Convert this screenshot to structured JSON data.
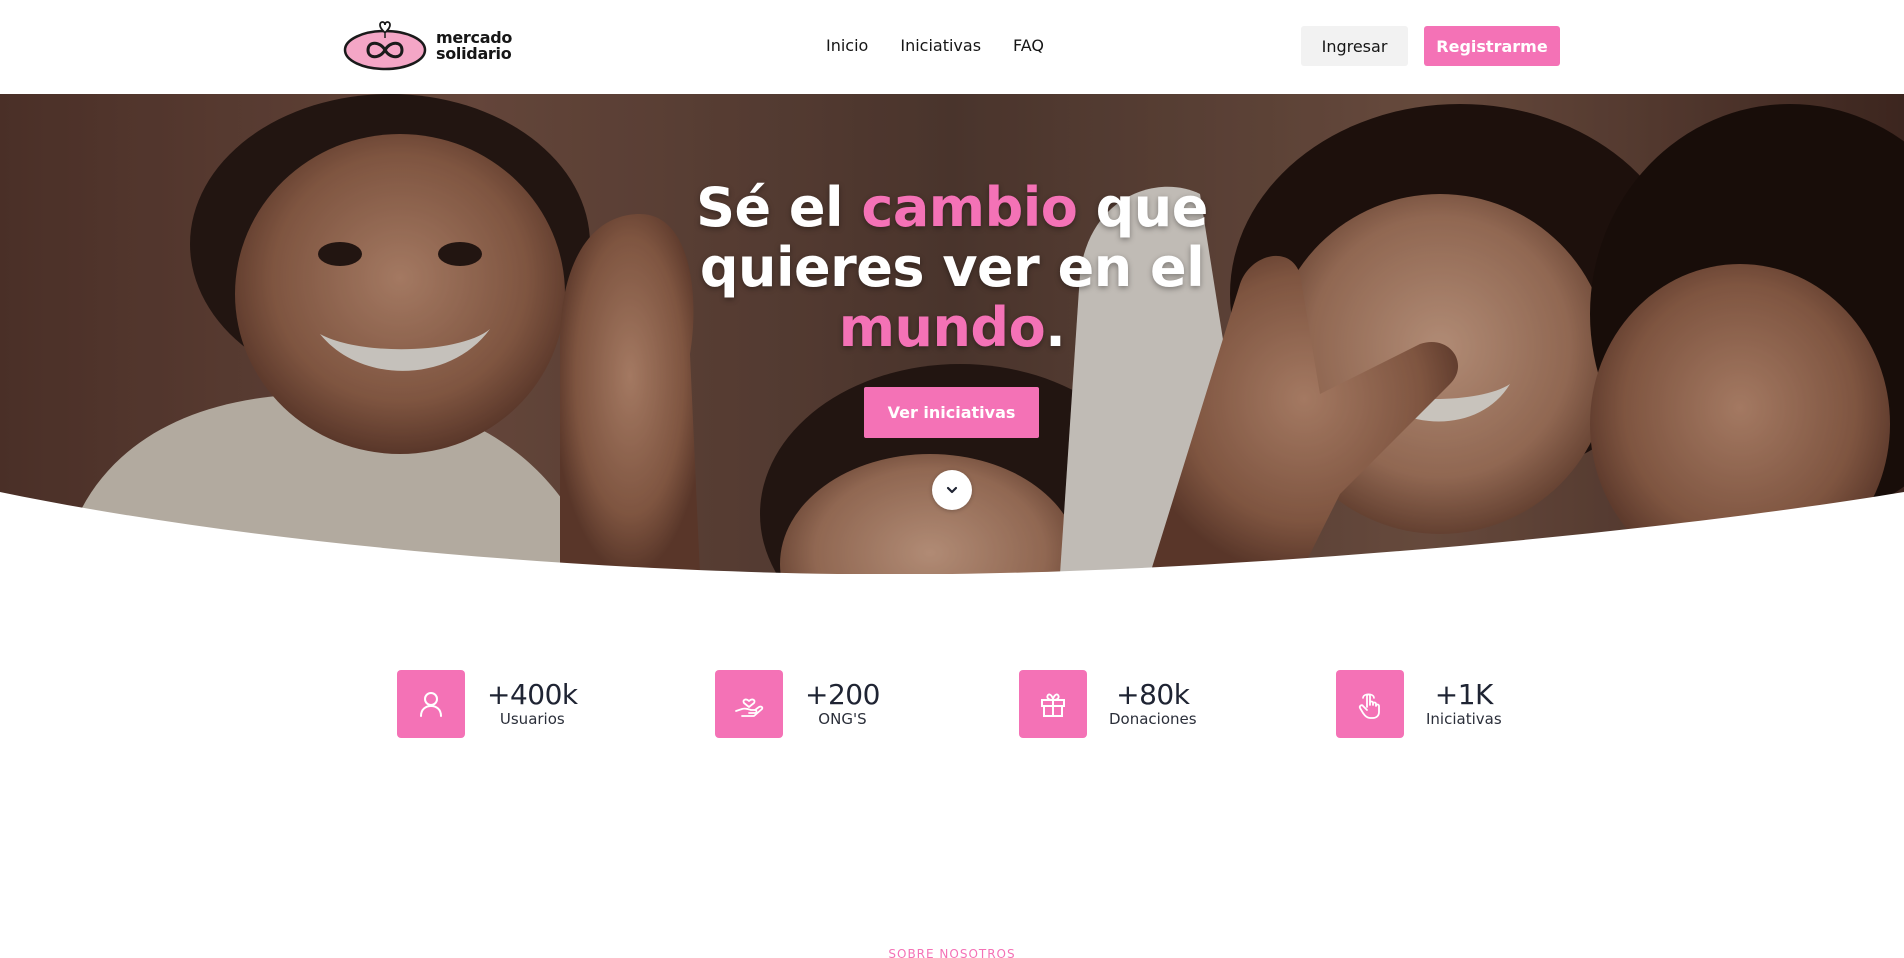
{
  "brand": {
    "line1": "mercado",
    "line2": "solidario",
    "accent_color": "#f472b6"
  },
  "nav": {
    "items": [
      "Inicio",
      "Iniciativas",
      "FAQ"
    ]
  },
  "auth": {
    "login_label": "Ingresar",
    "register_label": "Registrarme"
  },
  "hero": {
    "title_part1": "Sé el ",
    "title_accent1": "cambio",
    "title_part2": " que quieres ver en el ",
    "title_accent2": "mundo",
    "title_end": ".",
    "cta_label": "Ver iniciativas",
    "scroll_icon": "chevron-down-icon"
  },
  "stats": [
    {
      "value": "+400k",
      "label": "Usuarios",
      "icon": "user-icon"
    },
    {
      "value": "+200",
      "label": "ONG'S",
      "icon": "heart-hand-icon"
    },
    {
      "value": "+80k",
      "label": "Donaciones",
      "icon": "gift-icon"
    },
    {
      "value": "+1K",
      "label": "Iniciativas",
      "icon": "pointer-hand-icon"
    }
  ],
  "about": {
    "section_label": "SOBRE NOSOTROS"
  }
}
